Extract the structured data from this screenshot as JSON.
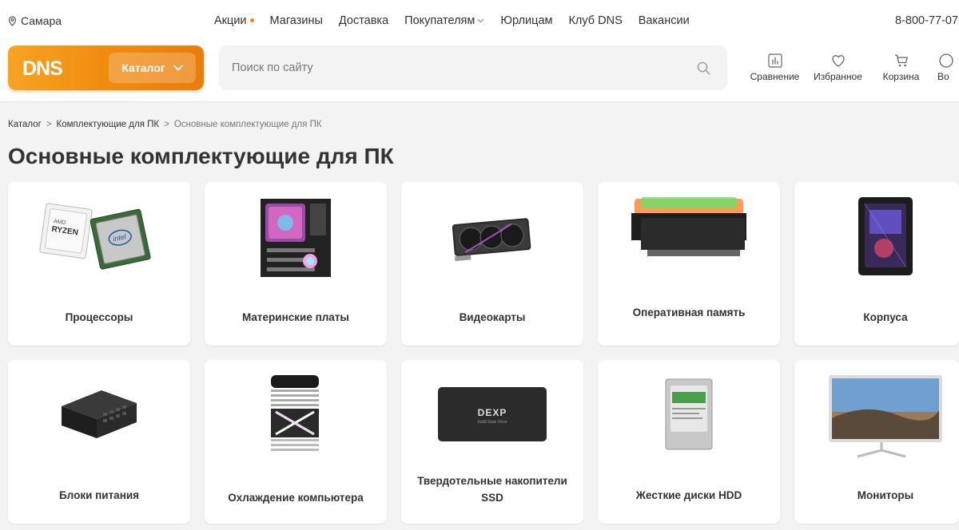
{
  "header": {
    "city": "Самара",
    "nav": [
      {
        "label": "Акции",
        "dot": true
      },
      {
        "label": "Магазины"
      },
      {
        "label": "Доставка"
      },
      {
        "label": "Покупателям",
        "dropdown": true
      },
      {
        "label": "Юрлицам"
      },
      {
        "label": "Клуб DNS"
      },
      {
        "label": "Вакансии"
      }
    ],
    "phone": "8-800-77-07-",
    "logo_text": "DNS",
    "catalog_label": "Каталог",
    "search_placeholder": "Поиск по сайту",
    "actions": [
      {
        "label": "Сравнение",
        "icon": "compare-icon"
      },
      {
        "label": "Избранное",
        "icon": "heart-icon"
      },
      {
        "label": "Корзина",
        "icon": "cart-icon"
      },
      {
        "label": "Во",
        "icon": "user-icon"
      }
    ]
  },
  "breadcrumb": [
    "Каталог",
    "Комплектующие для ПК",
    "Основные комплектующие для ПК"
  ],
  "page_title": "Основные комплектующие для ПК",
  "categories": [
    {
      "label": "Процессоры",
      "icon": "cpu-image"
    },
    {
      "label": "Материнские платы",
      "icon": "motherboard-image"
    },
    {
      "label": "Видеокарты",
      "icon": "gpu-image"
    },
    {
      "label": "Оперативная память",
      "icon": "ram-image"
    },
    {
      "label": "Корпуса",
      "icon": "case-image"
    },
    {
      "label": "Блоки питания",
      "icon": "psu-image"
    },
    {
      "label": "Охлаждение компьютера",
      "icon": "cooler-image"
    },
    {
      "label": "Твердотельные накопители SSD",
      "icon": "ssd-image",
      "brand": "DEXP",
      "sub": "Solid State Drive"
    },
    {
      "label": "Жесткие диски HDD",
      "icon": "hdd-image"
    },
    {
      "label": "Мониторы",
      "icon": "monitor-image"
    }
  ],
  "colors": {
    "brand_orange": "#f08c10",
    "accent_dot": "#fc8507",
    "text": "#333333",
    "muted": "#777777"
  }
}
